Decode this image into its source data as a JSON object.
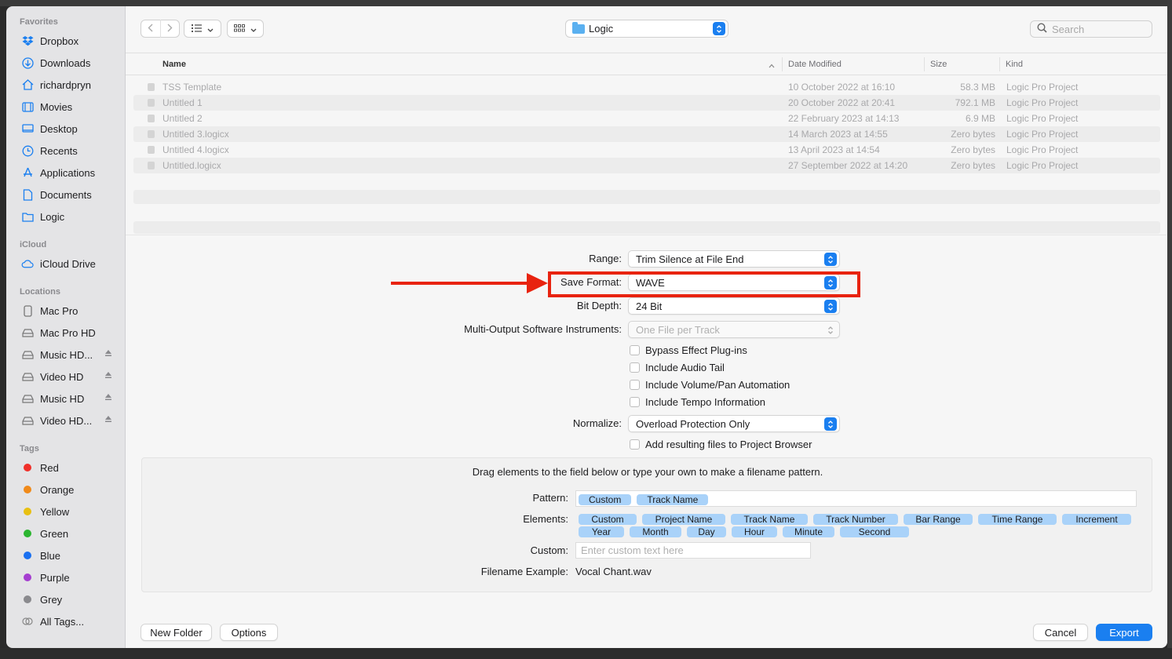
{
  "sidebar": {
    "favorites_title": "Favorites",
    "favorites": [
      {
        "label": "Dropbox",
        "icon": "dropbox-icon"
      },
      {
        "label": "Downloads",
        "icon": "download-icon"
      },
      {
        "label": "richardpryn",
        "icon": "home-icon"
      },
      {
        "label": "Movies",
        "icon": "film-icon"
      },
      {
        "label": "Desktop",
        "icon": "desktop-icon"
      },
      {
        "label": "Recents",
        "icon": "clock-icon"
      },
      {
        "label": "Applications",
        "icon": "applications-icon"
      },
      {
        "label": "Documents",
        "icon": "document-icon"
      },
      {
        "label": "Logic",
        "icon": "folder-icon"
      }
    ],
    "icloud_title": "iCloud",
    "icloud": [
      {
        "label": "iCloud Drive",
        "icon": "cloud-icon"
      }
    ],
    "locations_title": "Locations",
    "locations": [
      {
        "label": "Mac Pro",
        "icon": "computer-icon",
        "eject": false
      },
      {
        "label": "Mac Pro HD",
        "icon": "disk-icon",
        "eject": false
      },
      {
        "label": "Music HD...",
        "icon": "disk-icon",
        "eject": true
      },
      {
        "label": "Video HD",
        "icon": "disk-icon",
        "eject": true
      },
      {
        "label": "Music HD",
        "icon": "disk-icon",
        "eject": true
      },
      {
        "label": "Video HD...",
        "icon": "disk-icon",
        "eject": true
      }
    ],
    "tags_title": "Tags",
    "tags": [
      {
        "label": "Red",
        "color": "#f0302a"
      },
      {
        "label": "Orange",
        "color": "#f08a1a"
      },
      {
        "label": "Yellow",
        "color": "#e8c012"
      },
      {
        "label": "Green",
        "color": "#2bb530"
      },
      {
        "label": "Blue",
        "color": "#1a70f0"
      },
      {
        "label": "Purple",
        "color": "#a53ed0"
      },
      {
        "label": "Grey",
        "color": "#8a8a8e"
      }
    ],
    "all_tags": "All Tags..."
  },
  "toolbar": {
    "back_icon": "chevron-left-icon",
    "forward_icon": "chevron-right-icon",
    "folder_name": "Logic",
    "search_placeholder": "Search"
  },
  "file_list": {
    "columns": {
      "name": "Name",
      "date": "Date Modified",
      "size": "Size",
      "kind": "Kind"
    },
    "rows": [
      {
        "name": "TSS Template",
        "date": "10 October 2022 at 16:10",
        "size": "58.3 MB",
        "kind": "Logic Pro Project"
      },
      {
        "name": "Untitled 1",
        "date": "20 October 2022 at 20:41",
        "size": "792.1 MB",
        "kind": "Logic Pro Project"
      },
      {
        "name": "Untitled 2",
        "date": "22 February 2023 at 14:13",
        "size": "6.9 MB",
        "kind": "Logic Pro Project"
      },
      {
        "name": "Untitled 3.logicx",
        "date": "14 March 2023 at 14:55",
        "size": "Zero bytes",
        "kind": "Logic Pro Project"
      },
      {
        "name": "Untitled 4.logicx",
        "date": "13 April 2023 at 14:54",
        "size": "Zero bytes",
        "kind": "Logic Pro Project"
      },
      {
        "name": "Untitled.logicx",
        "date": "27 September 2022 at 14:20",
        "size": "Zero bytes",
        "kind": "Logic Pro Project"
      }
    ]
  },
  "options": {
    "range_label": "Range:",
    "range_value": "Trim Silence at File End",
    "format_label": "Save Format:",
    "format_value": "WAVE",
    "bitdepth_label": "Bit Depth:",
    "bitdepth_value": "24 Bit",
    "multi_label": "Multi-Output Software Instruments:",
    "multi_value": "One File per Track",
    "bypass": "Bypass Effect Plug-ins",
    "audio_tail": "Include Audio Tail",
    "volpan": "Include Volume/Pan Automation",
    "tempo": "Include Tempo Information",
    "normalize_label": "Normalize:",
    "normalize_value": "Overload Protection Only",
    "add_files": "Add resulting files to Project Browser"
  },
  "filename": {
    "instructions": "Drag elements to the field below or type your own to make a filename pattern.",
    "pattern_label": "Pattern:",
    "pattern_tokens": [
      "Custom",
      "Track Name"
    ],
    "elements_label": "Elements:",
    "elements": [
      "Custom",
      "Project Name",
      "Track Name",
      "Track Number",
      "Bar Range",
      "Time Range",
      "Increment",
      "Year",
      "Month",
      "Day",
      "Hour",
      "Minute",
      "Second"
    ],
    "custom_label": "Custom:",
    "custom_placeholder": "Enter custom text here",
    "example_label": "Filename Example:",
    "example_value": "Vocal Chant.wav"
  },
  "buttons": {
    "new_folder": "New Folder",
    "options": "Options",
    "cancel": "Cancel",
    "export": "Export"
  },
  "annotation": {
    "color": "#e8230f"
  }
}
